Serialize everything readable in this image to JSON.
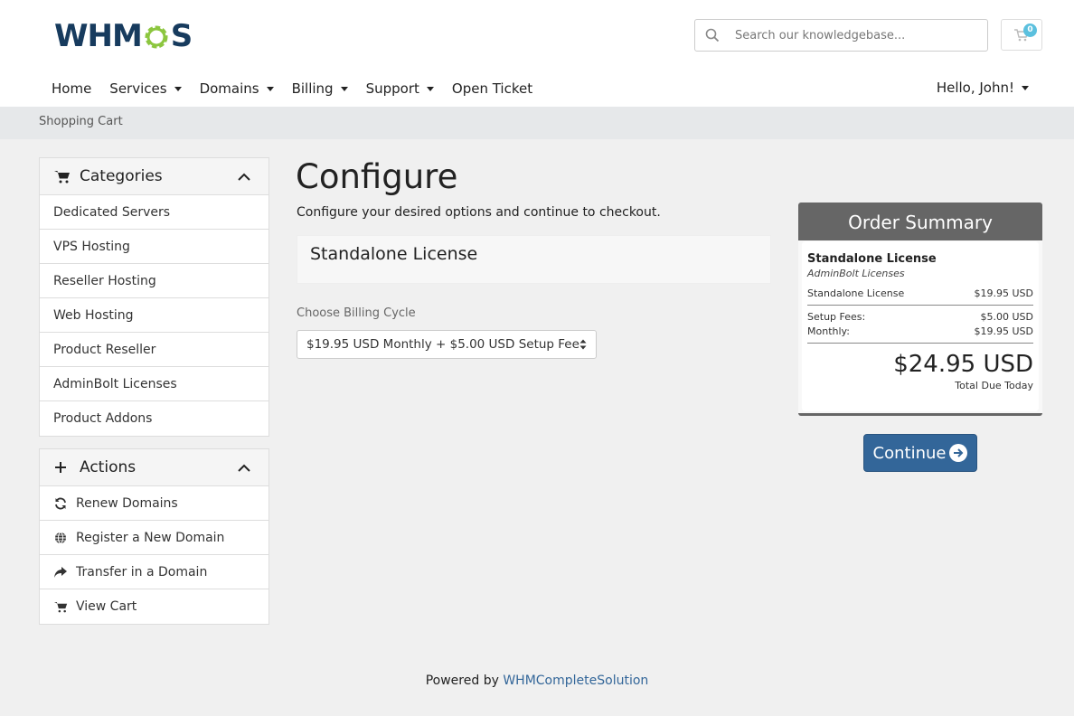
{
  "brand": {
    "logo_text_pre": "WHM",
    "logo_text_post": "S",
    "accent": "#8cc63f",
    "logo_color": "#173b5e"
  },
  "search": {
    "placeholder": "Search our knowledgebase..."
  },
  "cart": {
    "count": "0",
    "badge_color": "#5bc0de"
  },
  "nav": {
    "items": [
      {
        "label": "Home",
        "dropdown": false
      },
      {
        "label": "Services",
        "dropdown": true
      },
      {
        "label": "Domains",
        "dropdown": true
      },
      {
        "label": "Billing",
        "dropdown": true
      },
      {
        "label": "Support",
        "dropdown": true
      },
      {
        "label": "Open Ticket",
        "dropdown": false
      }
    ],
    "user": "Hello, John!"
  },
  "breadcrumb": {
    "current": "Shopping Cart"
  },
  "sidebar": {
    "categories": {
      "title": "Categories",
      "icon": "cart-icon",
      "items": [
        {
          "label": "Dedicated Servers"
        },
        {
          "label": "VPS Hosting"
        },
        {
          "label": "Reseller Hosting"
        },
        {
          "label": "Web Hosting"
        },
        {
          "label": "Product Reseller"
        },
        {
          "label": "AdminBolt Licenses"
        },
        {
          "label": "Product Addons"
        }
      ]
    },
    "actions": {
      "title": "Actions",
      "icon": "plus-icon",
      "items": [
        {
          "label": "Renew Domains",
          "icon": "refresh-icon"
        },
        {
          "label": "Register a New Domain",
          "icon": "globe-icon"
        },
        {
          "label": "Transfer in a Domain",
          "icon": "share-icon"
        },
        {
          "label": "View Cart",
          "icon": "cart-icon"
        }
      ]
    }
  },
  "main": {
    "title": "Configure",
    "subtitle": "Configure your desired options and continue to checkout.",
    "product_name": "Standalone License",
    "billing_label": "Choose Billing Cycle",
    "billing_value": "$19.95 USD Monthly + $5.00 USD Setup Fee"
  },
  "summary": {
    "title": "Order Summary",
    "product": "Standalone License",
    "group": "AdminBolt Licenses",
    "line_label": "Standalone License",
    "line_price": "$19.95 USD",
    "setup_label": "Setup Fees:",
    "setup_price": "$5.00 USD",
    "monthly_label": "Monthly:",
    "monthly_price": "$19.95 USD",
    "total": "$24.95 USD",
    "total_label": "Total Due Today"
  },
  "continue_label": "Continue",
  "footer": {
    "prefix": "Powered by",
    "link": "WHMCompleteSolution",
    "link_color": "#336699"
  }
}
